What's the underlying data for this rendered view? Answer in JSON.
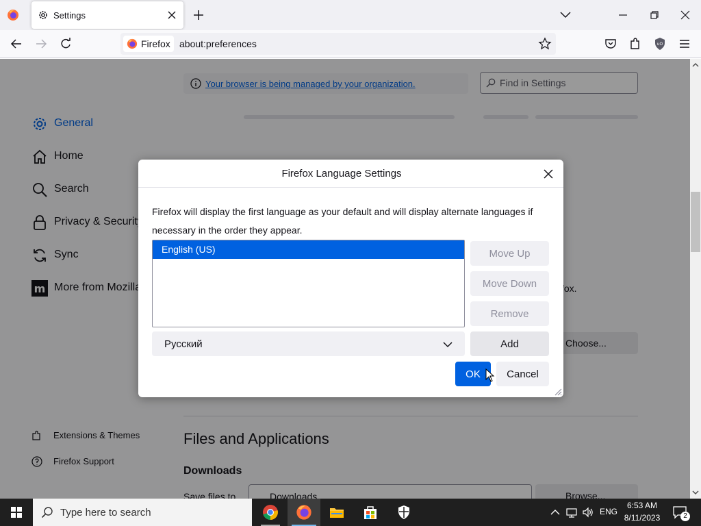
{
  "browser": {
    "tab_title": "Settings",
    "identity_label": "Firefox",
    "url": "about:preferences"
  },
  "prefs": {
    "managed_notice": "Your browser is being managed by your organization.",
    "find_placeholder": "Find in Settings",
    "categories": [
      {
        "label": "General",
        "icon": "gear-icon",
        "selected": true
      },
      {
        "label": "Home",
        "icon": "home-icon"
      },
      {
        "label": "Search",
        "icon": "search-icon"
      },
      {
        "label": "Privacy & Security",
        "icon": "lock-icon"
      },
      {
        "label": "Sync",
        "icon": "sync-icon"
      },
      {
        "label": "More from Mozilla",
        "icon": "mozilla-icon"
      }
    ],
    "footer_links": [
      {
        "label": "Extensions & Themes",
        "icon": "puzzle-icon"
      },
      {
        "label": "Firefox Support",
        "icon": "help-icon"
      }
    ],
    "bg_partial_text": "fox.",
    "bg_choose_button": "Choose...",
    "section_files": "Files and Applications",
    "section_downloads": "Downloads",
    "save_files_label": "Save files to",
    "downloads_field_value": "Downloads",
    "browse_button": "Browse..."
  },
  "dialog": {
    "title": "Firefox Language Settings",
    "description": "Firefox will display the first language as your default and will display alternate languages if necessary in the order they appear.",
    "languages": [
      "English (US)"
    ],
    "move_up": "Move Up",
    "move_down": "Move Down",
    "remove": "Remove",
    "select_value": "Русский",
    "add": "Add",
    "ok": "OK",
    "cancel": "Cancel"
  },
  "taskbar": {
    "search_placeholder": "Type here to search",
    "apps": [
      "chrome-icon",
      "firefox-icon",
      "file-explorer-icon",
      "store-icon",
      "security-icon"
    ],
    "language": "ENG",
    "time": "6:53 AM",
    "date": "8/11/2023",
    "notification_count": "2"
  },
  "colors": {
    "accent": "#0061e0",
    "selected_row": "#0061e0",
    "ok_button": "#0061e0",
    "taskbar": "#1f1f1f"
  }
}
